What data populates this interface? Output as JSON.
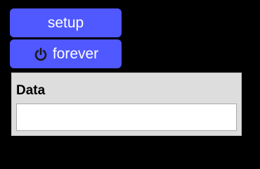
{
  "buttons": {
    "setup_label": "setup",
    "forever_label": "forever",
    "forever_icon": "power-icon",
    "color": "#5058ff"
  },
  "monitor": {
    "label": "Data",
    "value": ""
  }
}
